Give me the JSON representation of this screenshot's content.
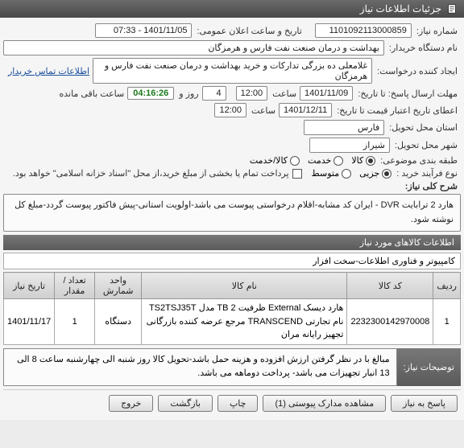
{
  "title": "جزئیات اطلاعات نیاز",
  "fields": {
    "need_no_lbl": "شماره نیاز:",
    "need_no": "1101092113000859",
    "ann_lbl": "تاریخ و ساعت اعلان عمومی:",
    "ann": "1401/11/05 - 07:33",
    "buyer_lbl": "نام دستگاه خریدار:",
    "buyer": "بهداشت و درمان صنعت نفت فارس و هرمزگان",
    "creator_lbl": "ایجاد کننده درخواست:",
    "creator": "غلامعلی ده بزرگی تدارکات و خرید بهداشت و درمان صنعت نفت فارس و هرمزگان",
    "contact_link": "اطلاعات تماس خریدار",
    "deadline_lbl": "مهلت ارسال پاسخ: تا تاریخ:",
    "deadline_date": "1401/11/09",
    "time_lbl": "ساعت",
    "deadline_time": "12:00",
    "days_lbl": "روز و",
    "days": "4",
    "remain_time": "04:16:26",
    "remain_lbl": "ساعت باقی مانده",
    "valid_lbl": "اعطای تاریخ اعتبار قیمت تا تاریخ:",
    "valid_date": "1401/12/11",
    "valid_time": "12:00",
    "province_lbl": "استان محل تحویل:",
    "province": "فارس",
    "city_lbl": "شهر محل تحویل:",
    "city": "شیراز",
    "class_lbl": "طبقه بندی موضوعی:",
    "class_opts": {
      "goods": "کالا",
      "service": "خدمت",
      "goods_service": "کالا/خدمت"
    },
    "proc_lbl": "نوع فرآیند خرید :",
    "proc_opts": {
      "partial": "جزیی",
      "medium": "متوسط"
    },
    "partial_note": "پرداخت تمام یا بخشی از مبلغ خرید،از محل \"اسناد خزانه اسلامی\" خواهد بود.",
    "desc_title": "شرح کلی نیاز:",
    "desc": "هارد 2 ترابایت DVR - ایران کد مشابه-اقلام درخواستی پیوست می باشد-اولویت استانی-پیش فاکتور پیوست گردد-مبلغ کل نوشته شود.",
    "goods_section": "اطلاعات کالاهای مورد نیاز",
    "goods_header": "کامپیوتر و فناوری اطلاعات-سخت افزار",
    "cols": {
      "row": "ردیف",
      "code": "کد کالا",
      "name": "نام کالا",
      "unit": "واحد شمارش",
      "qty": "تعداد / مقدار",
      "date": "تاریخ نیاز"
    },
    "rows": [
      {
        "row": "1",
        "code": "2232300142970008",
        "name": "هارد دیسک External ظرفیت TB 2 مدل TS2TSJ35T نام تجارتی TRANSCEND مرجع عرضه کننده بازرگانی تجهیز رایانه مران",
        "unit": "دستگاه",
        "qty": "1",
        "date": "1401/11/17"
      }
    ],
    "notes_lbl": "توضیحات نیاز:",
    "notes": "مبالغ با در نظر گرفتن ارزش افزوده و هزینه حمل باشد-تحویل کالا روز شنبه الی چهارشنبه ساعت 8 الی 13 انبار تجهیزات می باشد- پرداخت دوماهه می باشد.",
    "btns": {
      "reply": "پاسخ به نیاز",
      "view_docs": "مشاهده مدارک پیوستی (1)",
      "print": "چاپ",
      "back": "بازگشت",
      "exit": "خروج"
    }
  }
}
